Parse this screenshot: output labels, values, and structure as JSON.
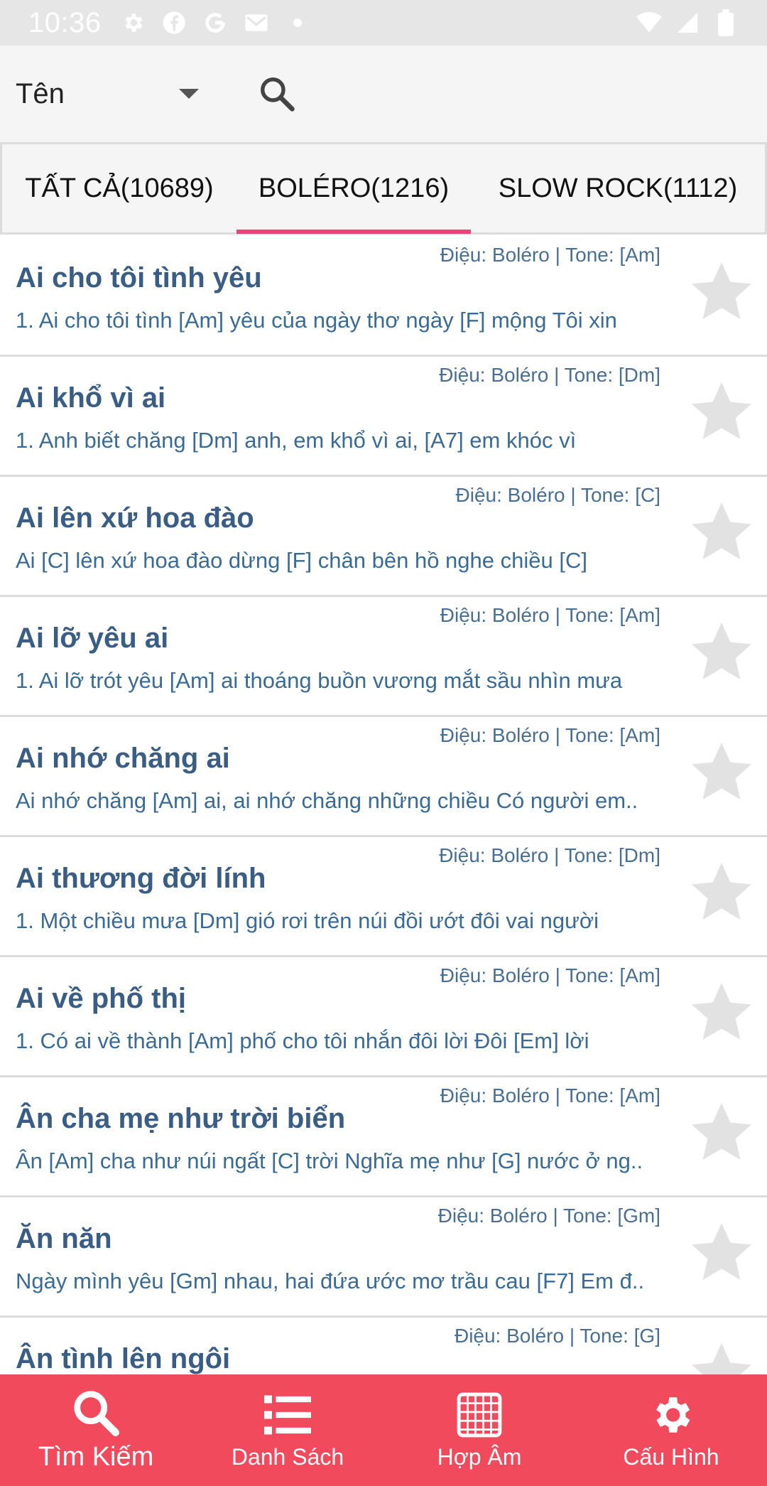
{
  "status_bar": {
    "time": "10:36",
    "left_icons": [
      "gear-icon",
      "facebook-icon",
      "google-icon",
      "gmail-icon",
      "dot-icon"
    ],
    "right_icons": [
      "wifi-icon",
      "signal-icon",
      "battery-icon"
    ]
  },
  "search": {
    "field_label": "Tên"
  },
  "tabs": [
    {
      "label": "TẤT CẢ(10689)",
      "active": false
    },
    {
      "label": "BOLÉRO(1216)",
      "active": true
    },
    {
      "label": "SLOW ROCK(1112)",
      "active": false
    }
  ],
  "songs": [
    {
      "meta": "Điệu: Boléro | Tone: [Am]",
      "title": "Ai cho tôi tình yêu",
      "lyric": "1. Ai cho tôi tình [Am] yêu của ngày thơ ngày [F] mộng Tôi xin"
    },
    {
      "meta": "Điệu: Boléro | Tone: [Dm]",
      "title": "Ai khổ vì ai",
      "lyric": "1. Anh biết chăng [Dm] anh, em khổ vì ai, [A7] em khóc vì"
    },
    {
      "meta": "Điệu: Boléro | Tone: [C]",
      "title": "Ai lên xứ hoa đào",
      "lyric": "Ai [C] lên xứ hoa đào dừng [F] chân bên hồ nghe chiều [C]"
    },
    {
      "meta": "Điệu: Boléro | Tone: [Am]",
      "title": "Ai lỡ yêu ai",
      "lyric": "1. Ai lỡ trót yêu [Am] ai thoáng buồn vương mắt sầu nhìn mưa"
    },
    {
      "meta": "Điệu: Boléro | Tone: [Am]",
      "title": "Ai nhớ chăng ai",
      "lyric": "Ai nhớ chăng [Am] ai, ai nhớ chăng những chiều Có người em.."
    },
    {
      "meta": "Điệu: Boléro | Tone: [Dm]",
      "title": "Ai thương đời lính",
      "lyric": "1. Một chiều mưa [Dm] gió rơi trên núi đồi ướt đôi vai người"
    },
    {
      "meta": "Điệu: Boléro | Tone: [Am]",
      "title": "Ai về phố thị",
      "lyric": "1. Có ai về thành [Am] phố cho tôi nhắn đôi lời Đôi [Em] lời"
    },
    {
      "meta": "Điệu: Boléro | Tone: [Am]",
      "title": "Ân cha mẹ như trời biển",
      "lyric": "Ân [Am] cha như núi ngất [C] trời Nghĩa mẹ như [G] nước ở ng.."
    },
    {
      "meta": "Điệu: Boléro | Tone: [Gm]",
      "title": "Ăn năn",
      "lyric": "Ngày mình yêu [Gm] nhau, hai đứa ước mơ trầu cau [F7] Em đ.."
    },
    {
      "meta": "Điệu: Boléro | Tone: [G]",
      "title": "Ân tình lên ngôi",
      "lyric": ""
    }
  ],
  "nav": [
    {
      "label": "Tìm Kiếm",
      "icon": "search-icon",
      "active": true
    },
    {
      "label": "Danh Sách",
      "icon": "list-icon",
      "active": false
    },
    {
      "label": "Hợp Âm",
      "icon": "chord-chart-icon",
      "active": false
    },
    {
      "label": "Cấu Hình",
      "icon": "gear-icon",
      "active": false
    }
  ],
  "colors": {
    "accent": "#e8467a",
    "nav_background": "#f24a5d",
    "title": "#3a5d86",
    "lyric": "#3a6a96"
  }
}
